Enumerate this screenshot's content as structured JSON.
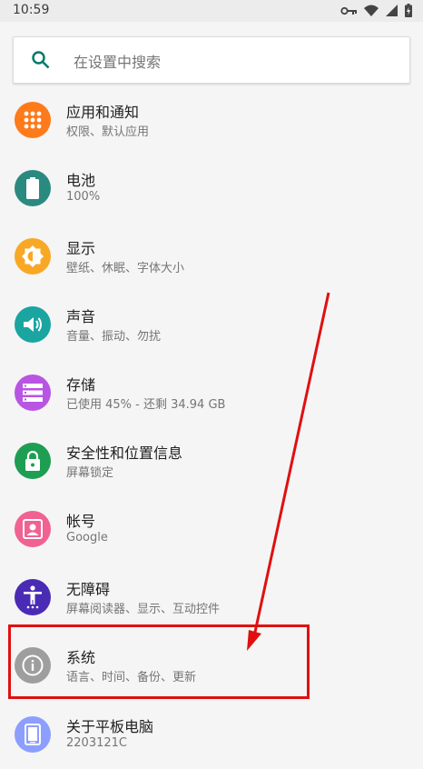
{
  "status_bar": {
    "time": "10:59",
    "icons": [
      "vpn-key-icon",
      "wifi-icon",
      "signal-icon",
      "battery-icon"
    ]
  },
  "search": {
    "placeholder": "在设置中搜索",
    "icon": "search-icon"
  },
  "settings_items": [
    {
      "title": "应用和通知",
      "subtitle": "权限、默认应用",
      "icon": "apps-grid-icon",
      "color": "#ff7a1a"
    },
    {
      "title": "电池",
      "subtitle": "100%",
      "icon": "battery-icon",
      "color": "#2a8a80"
    },
    {
      "title": "显示",
      "subtitle": "壁纸、休眠、字体大小",
      "icon": "brightness-icon",
      "color": "#f9a825"
    },
    {
      "title": "声音",
      "subtitle": "音量、振动、勿扰",
      "icon": "volume-icon",
      "color": "#1aa5a0"
    },
    {
      "title": "存储",
      "subtitle": "已使用 45% - 还剩 34.94 GB",
      "icon": "storage-icon",
      "color": "#b855e3"
    },
    {
      "title": "安全性和位置信息",
      "subtitle": "屏幕锁定",
      "icon": "lock-icon",
      "color": "#1e9e52"
    },
    {
      "title": "帐号",
      "subtitle": "Google",
      "icon": "account-box-icon",
      "color": "#f06292"
    },
    {
      "title": "无障碍",
      "subtitle": "屏幕阅读器、显示、互动控件",
      "icon": "accessibility-icon",
      "color": "#4a2bb5"
    },
    {
      "title": "系统",
      "subtitle": "语言、时间、备份、更新",
      "icon": "info-icon",
      "color": "#9e9e9e"
    },
    {
      "title": "关于平板电脑",
      "subtitle": "2203121C",
      "icon": "tablet-icon",
      "color": "#8c9eff"
    }
  ],
  "annotation": {
    "color": "#e01010",
    "highlighted_item": "系统"
  }
}
